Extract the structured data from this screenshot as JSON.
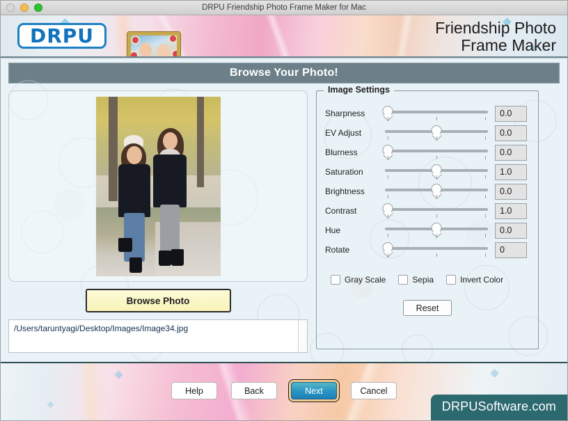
{
  "titlebar": {
    "title": "DRPU Friendship Photo Frame Maker for Mac",
    "close_label": "",
    "minimize_label": "",
    "maximize_label": ""
  },
  "banner": {
    "logo_text": "DRPU",
    "title_line1": "Friendship Photo",
    "title_line2": "Frame Maker"
  },
  "heading": {
    "text": "Browse Your Photo!"
  },
  "left": {
    "browse_button": "Browse Photo",
    "file_path": "/Users/taruntyagi/Desktop/Images/Image34.jpg"
  },
  "settings": {
    "legend": "Image Settings",
    "rows": [
      {
        "label": "Sharpness",
        "value": "0.0",
        "pos": 3
      },
      {
        "label": "EV Adjust",
        "value": "0.0",
        "pos": 50
      },
      {
        "label": "Blurness",
        "value": "0.0",
        "pos": 3
      },
      {
        "label": "Saturation",
        "value": "1.0",
        "pos": 50
      },
      {
        "label": "Brightness",
        "value": "0.0",
        "pos": 50
      },
      {
        "label": "Contrast",
        "value": "1.0",
        "pos": 3
      },
      {
        "label": "Hue",
        "value": "0.0",
        "pos": 50
      },
      {
        "label": "Rotate",
        "value": "0",
        "pos": 3
      }
    ],
    "checkboxes": [
      {
        "label": "Gray Scale",
        "checked": false
      },
      {
        "label": "Sepia",
        "checked": false
      },
      {
        "label": "Invert Color",
        "checked": false
      }
    ],
    "reset_label": "Reset"
  },
  "footer": {
    "buttons": [
      {
        "label": "Help",
        "primary": false
      },
      {
        "label": "Back",
        "primary": false
      },
      {
        "label": "Next",
        "primary": true
      },
      {
        "label": "Cancel",
        "primary": false
      }
    ],
    "watermark": "DRPUSoftware.com"
  },
  "colors": {
    "heading_bar": "#6d8089",
    "accent_blue": "#1172bd",
    "primary_button": "#2d96c4",
    "browse_button": "#f8f3b8",
    "watermark_bg": "#2c6a70"
  }
}
